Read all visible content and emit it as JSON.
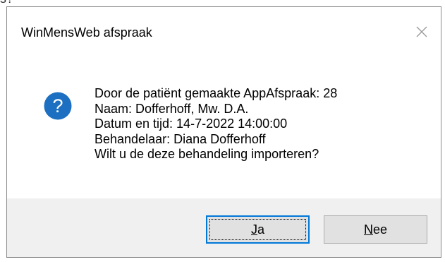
{
  "background": {
    "partial_text": "s?"
  },
  "dialog": {
    "title": "WinMensWeb afspraak",
    "close_icon": "close-icon",
    "icon": "question-icon",
    "icon_color": "#1c6fc1",
    "message_lines": [
      "Door de patiënt gemaakte AppAfspraak: 28",
      "Naam: Dofferhoff, Mw. D.A.",
      "Datum en tijd: 14-7-2022 14:00:00",
      "Behandelaar: Diana Dofferhoff",
      "Wilt u de deze behandeling importeren?"
    ],
    "buttons": {
      "yes": {
        "accel": "J",
        "rest": "a"
      },
      "no": {
        "accel": "N",
        "rest": "ee"
      }
    }
  }
}
